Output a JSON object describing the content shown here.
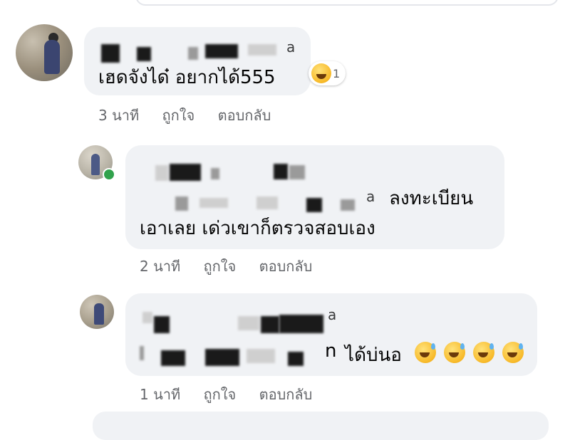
{
  "comments": [
    {
      "author_visible_tail": "a",
      "text": "เฮดจังได๋ อยากได้555",
      "reaction_count": "1",
      "reaction_icon": "laughing-emoji",
      "time": "3 นาที",
      "like_label": "ถูกใจ",
      "reply_label": "ตอบกลับ"
    },
    {
      "author_visible_tail": "a",
      "text_line1": "ลงทะเบียน",
      "text_line2": "เอาเลย เด่วเขาก็ตรวจสอบเอง",
      "time": "2 นาที",
      "like_label": "ถูกใจ",
      "reply_label": "ตอบกลับ"
    },
    {
      "author_visible_tail": "a",
      "name_partial": "n",
      "text": "ได้บ่นอ",
      "emojis": [
        "sweat-smile-emoji",
        "sweat-smile-emoji",
        "sweat-smile-emoji",
        "sweat-smile-emoji"
      ],
      "time": "1 นาที",
      "like_label": "ถูกใจ",
      "reply_label": "ตอบกลับ"
    }
  ],
  "colors": {
    "bubble": "#f0f2f5",
    "meta_text": "#65676b",
    "online": "#31a24c"
  }
}
